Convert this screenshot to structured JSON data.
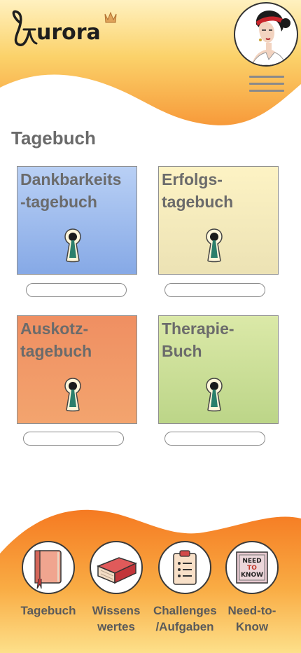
{
  "app": {
    "name": "urora"
  },
  "page": {
    "title": "Tagebuch"
  },
  "cards": [
    {
      "title": "Dankbarkeits\n-tagebuch",
      "icon": "keyhole-icon",
      "color": "#a9c4f1"
    },
    {
      "title": "Erfolgs-\ntagebuch",
      "icon": "keyhole-icon",
      "color": "#f7ecc0"
    },
    {
      "title": "Auskotz-\ntagebuch",
      "icon": "keyhole-icon",
      "color": "#f1996a"
    },
    {
      "title": "Therapie-\nBuch",
      "icon": "keyhole-icon",
      "color": "#cde19a"
    }
  ],
  "nav": [
    {
      "label": "Tagebuch",
      "icon": "diary-icon"
    },
    {
      "label": "Wissens\nwertes",
      "icon": "books-icon"
    },
    {
      "label": "Challenges\n/Aufgaben",
      "icon": "checklist-icon"
    },
    {
      "label": "Need-to-\nKnow",
      "icon": "need-to-know-sign-icon",
      "sign_lines": [
        "NEED",
        "TO",
        "KNOW"
      ]
    }
  ],
  "colors": {
    "accent_orange": "#f79a3a",
    "accent_yellow": "#fbd56a"
  }
}
